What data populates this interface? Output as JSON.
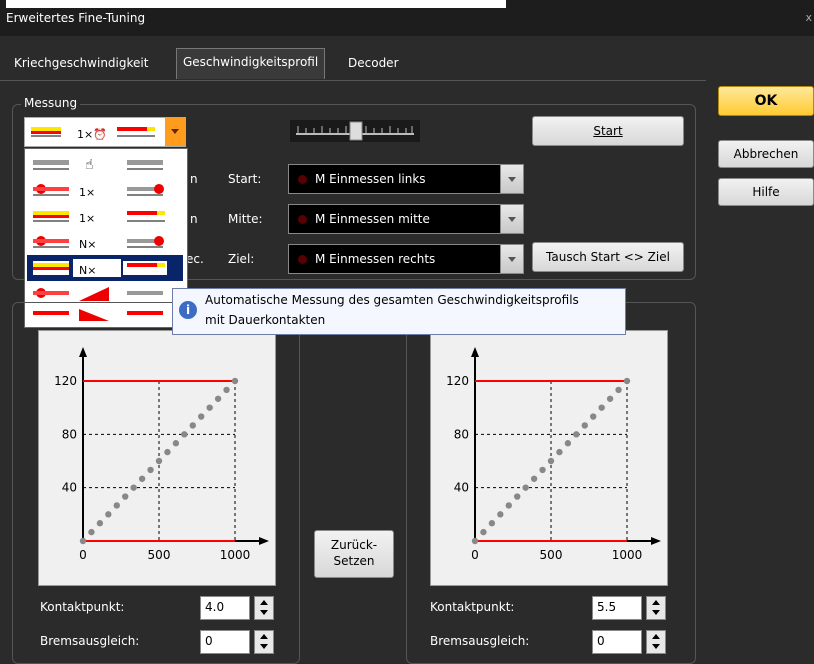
{
  "window": {
    "title": "Erweitertes Fine-Tuning",
    "close": "x"
  },
  "tabs": [
    {
      "label": "Kriechgeschwindigkeit",
      "active": false
    },
    {
      "label": "Geschwindigkeitsprofil",
      "active": true
    },
    {
      "label": "Decoder",
      "active": false
    }
  ],
  "buttons": {
    "ok": "OK",
    "cancel": "Abbrechen",
    "help": "Hilfe",
    "start": "Start",
    "swap": "Tausch Start <> Ziel",
    "reset_line1": "Zurück-",
    "reset_line2": "Setzen"
  },
  "measurement": {
    "group_label": "Messung",
    "mode_selected": "1×",
    "dropdown_items": [
      {
        "label": "",
        "icon": "manual-hand-icon"
      },
      {
        "label": "1×",
        "icon": "single-contact-red-icon"
      },
      {
        "label": "1×",
        "icon": "single-contact-yellow-icon"
      },
      {
        "label": "N×",
        "icon": "multi-contact-red-icon"
      },
      {
        "label": "N×",
        "icon": "multi-contact-yellow-icon",
        "selected": true
      },
      {
        "label": "",
        "icon": "ramp-red-icon"
      },
      {
        "label": "",
        "icon": "ramp-red-2-icon"
      }
    ],
    "hidden_labels": [
      "n",
      "n",
      "ec."
    ],
    "fields": [
      {
        "label": "Start:",
        "value": "M Einmessen links"
      },
      {
        "label": "Mitte:",
        "value": "M Einmessen mitte"
      },
      {
        "label": "Ziel:",
        "value": "M Einmessen rechts"
      }
    ]
  },
  "tooltip": {
    "line1": "Automatische Messung des gesamten Geschwindigkeitsprofils",
    "line2": "mit Dauerkontakten"
  },
  "chart_data": [
    {
      "type": "line",
      "x": [
        0,
        1000
      ],
      "y": [
        0,
        120
      ],
      "xticks": [
        "0",
        "500",
        "1000"
      ],
      "yticks": [
        "120",
        "80",
        "40"
      ],
      "ylim": [
        0,
        120
      ],
      "xlim": [
        0,
        1000
      ],
      "grid": true,
      "red_lines_y": [
        120,
        0
      ]
    },
    {
      "type": "line",
      "x": [
        0,
        1000
      ],
      "y": [
        0,
        120
      ],
      "xticks": [
        "0",
        "500",
        "1000"
      ],
      "yticks": [
        "120",
        "80",
        "40"
      ],
      "ylim": [
        0,
        120
      ],
      "xlim": [
        0,
        1000
      ],
      "grid": true,
      "red_lines_y": [
        120,
        0
      ]
    }
  ],
  "left_params": {
    "contact_label": "Kontaktpunkt:",
    "contact_value": "4.0",
    "brake_label": "Bremsausgleich:",
    "brake_value": "0"
  },
  "right_params": {
    "contact_label": "Kontaktpunkt:",
    "contact_value": "5.5",
    "brake_label": "Bremsausgleich:",
    "brake_value": "0"
  },
  "colors": {
    "accent_ok": "#ffcc33",
    "red": "#ff0000",
    "dot": "#5a0000"
  }
}
